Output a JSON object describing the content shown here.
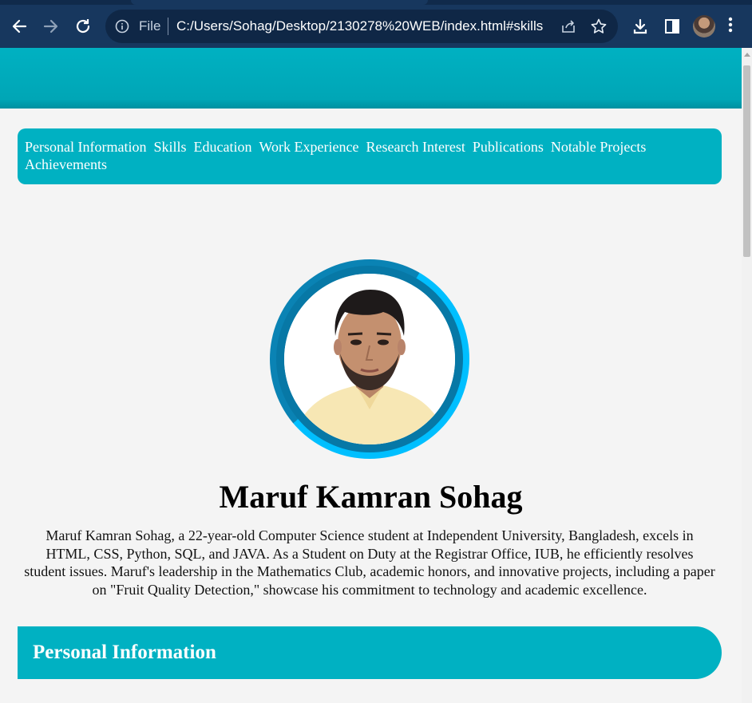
{
  "browser": {
    "file_label": "File",
    "url": "C:/Users/Sohag/Desktop/2130278%20WEB/index.html#skills"
  },
  "nav": {
    "items": [
      "Personal Information",
      "Skills",
      "Education",
      "Work Experience",
      "Research Interest",
      "Publications",
      "Notable Projects",
      "Achievements"
    ]
  },
  "profile": {
    "name": "Maruf Kamran Sohag",
    "bio": "Maruf Kamran Sohag, a 22-year-old Computer Science student at Independent University, Bangladesh, excels in HTML, CSS, Python, SQL, and JAVA. As a Student on Duty at the Registrar Office, IUB, he efficiently resolves student issues. Maruf's leadership in the Mathematics Club, academic honors, and innovative projects, including a paper on \"Fruit Quality Detection,\" showcase his commitment to technology and academic excellence."
  },
  "section": {
    "title": "Personal Information"
  },
  "colors": {
    "accent": "#00b1c2",
    "ring_light": "#00bfff",
    "ring_dark": "#0778a6",
    "chrome": "#17375e"
  }
}
